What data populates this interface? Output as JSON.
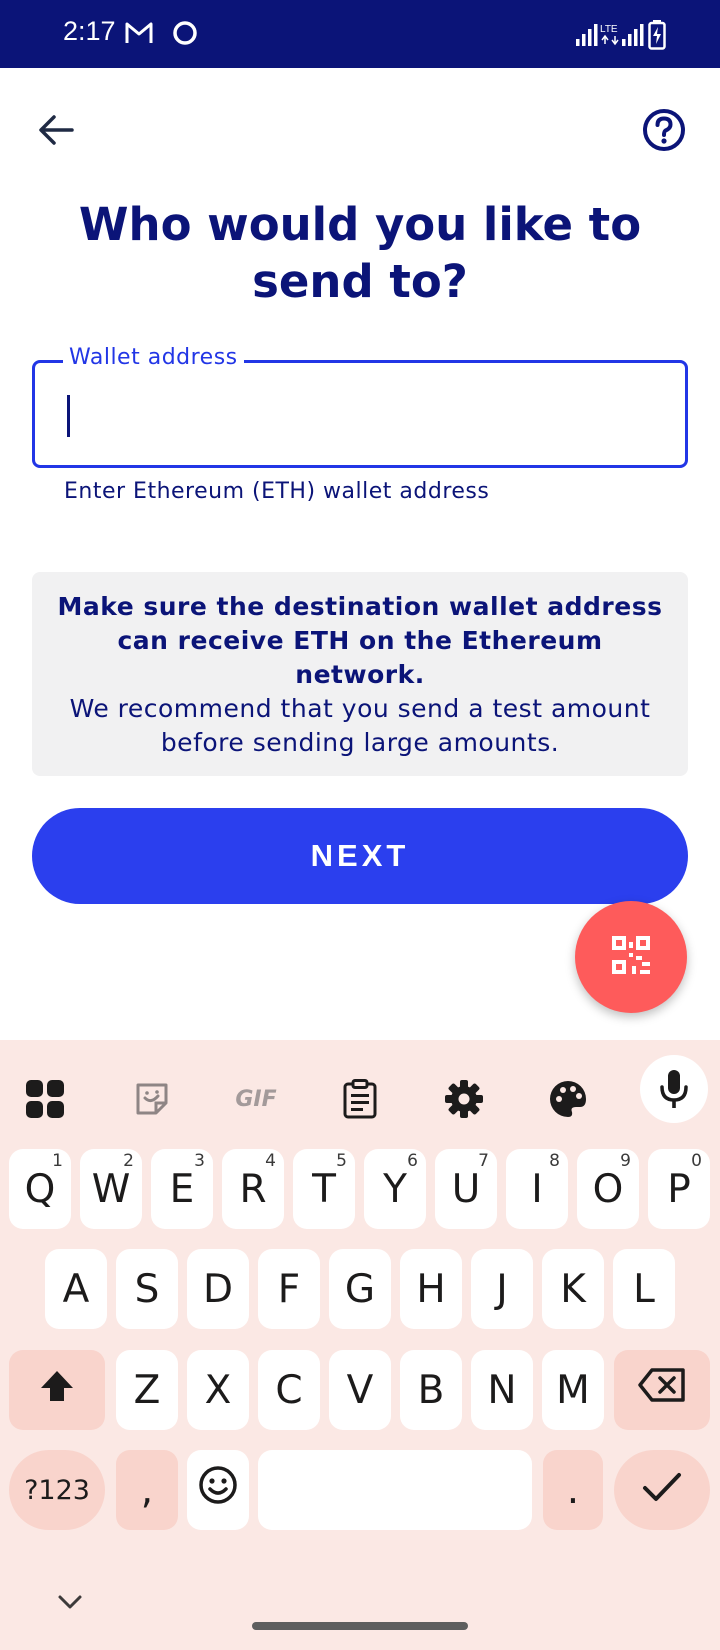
{
  "status_bar": {
    "time": "2:17",
    "icons": [
      "gmail-icon",
      "circle-icon",
      "signal-icon",
      "lte-icon",
      "signal-icon",
      "battery-charging-icon"
    ]
  },
  "header": {
    "back_icon": "arrow-left-icon",
    "help_icon": "help-circle-icon"
  },
  "page": {
    "title": "Who would you like to send to?"
  },
  "wallet_input": {
    "label": "Wallet address",
    "value": "",
    "helper": "Enter Ethereum (ETH) wallet address"
  },
  "notice": {
    "strong": "Make sure the destination wallet address can receive ETH on the Ethereum network.",
    "body": "We recommend that you send a test amount before sending large amounts."
  },
  "next_button": {
    "label": "NEXT"
  },
  "qr_button": {
    "icon": "qr-code-icon"
  },
  "colors": {
    "navy": "#0b1478",
    "accent_blue": "#2b3fee",
    "qr_red": "#fe5b5b",
    "keyboard_bg": "#fbe8e4"
  },
  "keyboard": {
    "toolbar": [
      "apps-icon",
      "sticker-icon",
      "gif-icon",
      "clipboard-icon",
      "settings-icon",
      "palette-icon",
      "microphone-icon"
    ],
    "gif_label": "GIF",
    "row1": [
      {
        "key": "Q",
        "sup": "1"
      },
      {
        "key": "W",
        "sup": "2"
      },
      {
        "key": "E",
        "sup": "3"
      },
      {
        "key": "R",
        "sup": "4"
      },
      {
        "key": "T",
        "sup": "5"
      },
      {
        "key": "Y",
        "sup": "6"
      },
      {
        "key": "U",
        "sup": "7"
      },
      {
        "key": "I",
        "sup": "8"
      },
      {
        "key": "O",
        "sup": "9"
      },
      {
        "key": "P",
        "sup": "0"
      }
    ],
    "row2": [
      "A",
      "S",
      "D",
      "F",
      "G",
      "H",
      "J",
      "K",
      "L"
    ],
    "row3": [
      "Z",
      "X",
      "C",
      "V",
      "B",
      "N",
      "M"
    ],
    "symbols_label": "?123",
    "comma_label": ",",
    "period_label": ".",
    "space_label": ""
  }
}
